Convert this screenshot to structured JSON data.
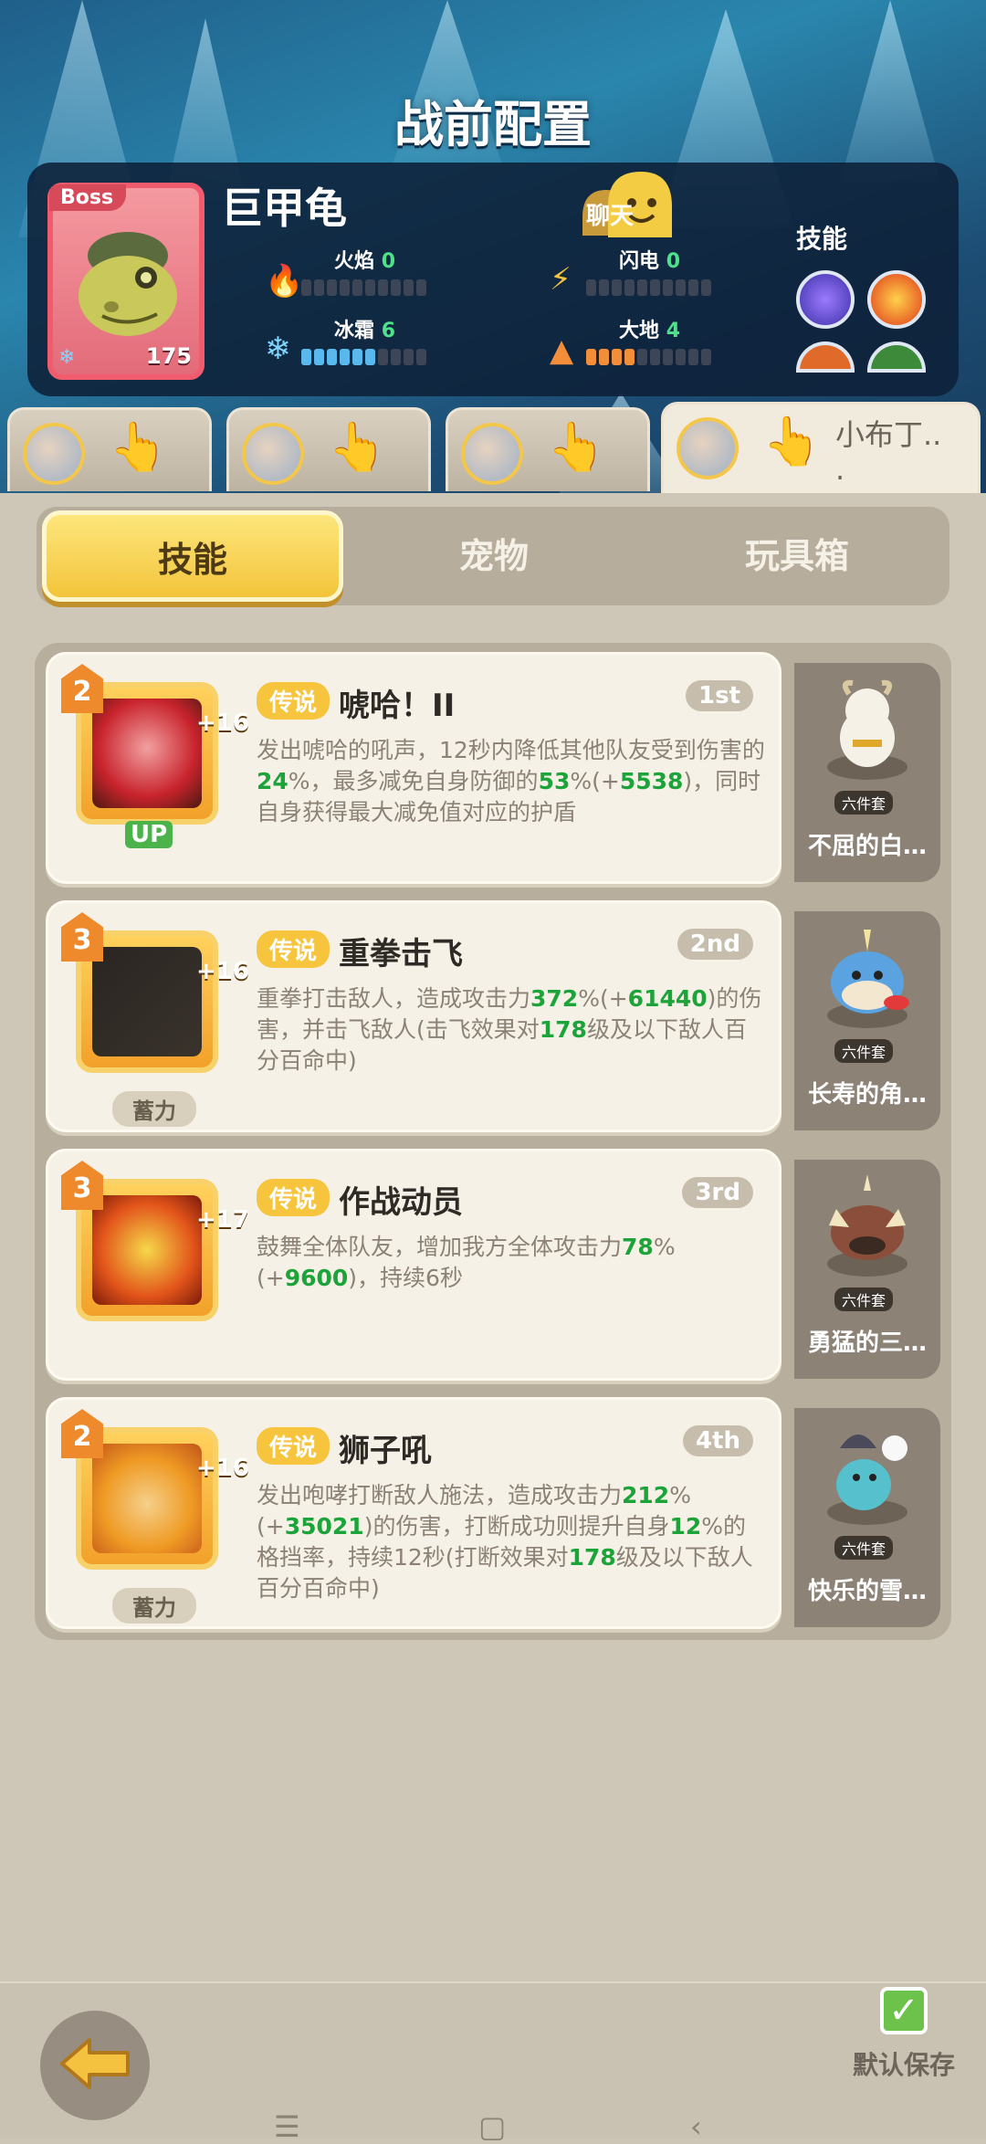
{
  "header": {
    "title": "战前配置"
  },
  "boss": {
    "tag": "Boss",
    "name": "巨甲龟",
    "level": "175",
    "chat_label": "聊天",
    "skills_label": "技能",
    "elements": [
      {
        "name": "火焰",
        "value": "0",
        "level": 0,
        "max": 10,
        "color": "#f26a3a"
      },
      {
        "name": "闪电",
        "value": "0",
        "level": 0,
        "max": 10,
        "color": "#f5c33a"
      },
      {
        "name": "冰霜",
        "value": "6",
        "level": 6,
        "max": 10,
        "color": "#59b9ec"
      },
      {
        "name": "大地",
        "value": "4",
        "level": 4,
        "max": 10,
        "color": "#f28e3a"
      }
    ]
  },
  "team_tabs": [
    {
      "name": ""
    },
    {
      "name": ""
    },
    {
      "name": ""
    },
    {
      "name": "小布丁..\n."
    }
  ],
  "tabs": [
    {
      "label": "技能",
      "active": true
    },
    {
      "label": "宠物",
      "active": false
    },
    {
      "label": "玩具箱",
      "active": false
    }
  ],
  "skills": [
    {
      "level": "2",
      "plus": "+16",
      "badge": "UP",
      "charge": "",
      "rarity": "传说",
      "name": "唬哈！II",
      "order": "1st",
      "desc": [
        {
          "t": "发出唬哈的吼声，12秒内降低其他队友受到伤害的"
        },
        {
          "t": "24",
          "h": true
        },
        {
          "t": "%，最多减免自身防御的"
        },
        {
          "t": "53",
          "h": true
        },
        {
          "t": "%(+"
        },
        {
          "t": "5538",
          "h": true
        },
        {
          "t": ")，同时自身获得最大减免值对应的护盾"
        }
      ],
      "pet": {
        "name": "不屈的白…",
        "set": "六件套"
      }
    },
    {
      "level": "3",
      "plus": "+16",
      "badge": "",
      "charge": "蓄力",
      "rarity": "传说",
      "name": "重拳击飞",
      "order": "2nd",
      "desc": [
        {
          "t": "重拳打击敌人，造成攻击力"
        },
        {
          "t": "372",
          "h": true
        },
        {
          "t": "%(+"
        },
        {
          "t": "61440",
          "h": true
        },
        {
          "t": ")的伤害，并击飞敌人(击飞效果对"
        },
        {
          "t": "178",
          "h": true
        },
        {
          "t": "级及以下敌人百分百命中)"
        }
      ],
      "pet": {
        "name": "长寿的角…",
        "set": "六件套"
      }
    },
    {
      "level": "3",
      "plus": "+17",
      "badge": "",
      "charge": "",
      "rarity": "传说",
      "name": "作战动员",
      "order": "3rd",
      "desc": [
        {
          "t": "鼓舞全体队友，增加我方全体攻击力"
        },
        {
          "t": "78",
          "h": true
        },
        {
          "t": "%(+"
        },
        {
          "t": "9600",
          "h": true
        },
        {
          "t": ")，持续6秒"
        }
      ],
      "pet": {
        "name": "勇猛的三…",
        "set": "六件套"
      }
    },
    {
      "level": "2",
      "plus": "+16",
      "badge": "",
      "charge": "蓄力",
      "rarity": "传说",
      "name": "狮子吼",
      "order": "4th",
      "desc": [
        {
          "t": "发出咆哮打断敌人施法，造成攻击力"
        },
        {
          "t": "212",
          "h": true
        },
        {
          "t": "%(+"
        },
        {
          "t": "35021",
          "h": true
        },
        {
          "t": ")的伤害，打断成功则提升自身"
        },
        {
          "t": "12",
          "h": true
        },
        {
          "t": "%的格挡率，持续12秒(打断效果对"
        },
        {
          "t": "178",
          "h": true
        },
        {
          "t": "级及以下敌人百分百命中)"
        }
      ],
      "pet": {
        "name": "快乐的雪…",
        "set": "六件套"
      }
    }
  ],
  "footer": {
    "save_label": "默认保存",
    "save_checked": true
  }
}
